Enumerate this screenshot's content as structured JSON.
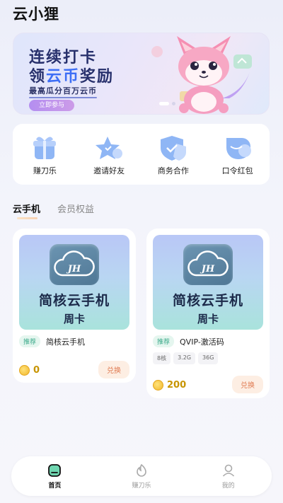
{
  "app": {
    "title": "云小狸"
  },
  "banner": {
    "line1": "连续打卡",
    "line2_prefix": "领",
    "line2_highlight": "云币",
    "line2_suffix": "奖励",
    "subtitle": "最高瓜分百万云币",
    "button": "立即参与"
  },
  "shortcuts": [
    {
      "label": "赚刀乐",
      "icon": "gift-box-icon"
    },
    {
      "label": "邀请好友",
      "icon": "star-invite-icon"
    },
    {
      "label": "商务合作",
      "icon": "shield-check-icon"
    },
    {
      "label": "口令红包",
      "icon": "red-packet-icon"
    }
  ],
  "tabs": [
    {
      "label": "云手机",
      "active": true
    },
    {
      "label": "会员权益",
      "active": false
    }
  ],
  "products": [
    {
      "thumb_title": "简核云手机",
      "thumb_sub": "周卡",
      "logo": "JH",
      "tag": "推荐",
      "name": "简核云手机",
      "specs": [],
      "price": "0",
      "button": "兑换"
    },
    {
      "thumb_title": "简核云手机",
      "thumb_sub": "周卡",
      "logo": "JH",
      "tag": "推荐",
      "name": "QVIP-激活码",
      "specs": [
        "8核",
        "3.2G",
        "36G"
      ],
      "price": "200",
      "button": "兑换"
    }
  ],
  "nav": [
    {
      "label": "首页",
      "active": true
    },
    {
      "label": "赚刀乐",
      "active": false
    },
    {
      "label": "我的",
      "active": false
    }
  ],
  "colors": {
    "accent": "#3d6ef5",
    "coin": "#f1b72c",
    "exchange": "#e07b52",
    "recommend": "#3aa98a"
  }
}
